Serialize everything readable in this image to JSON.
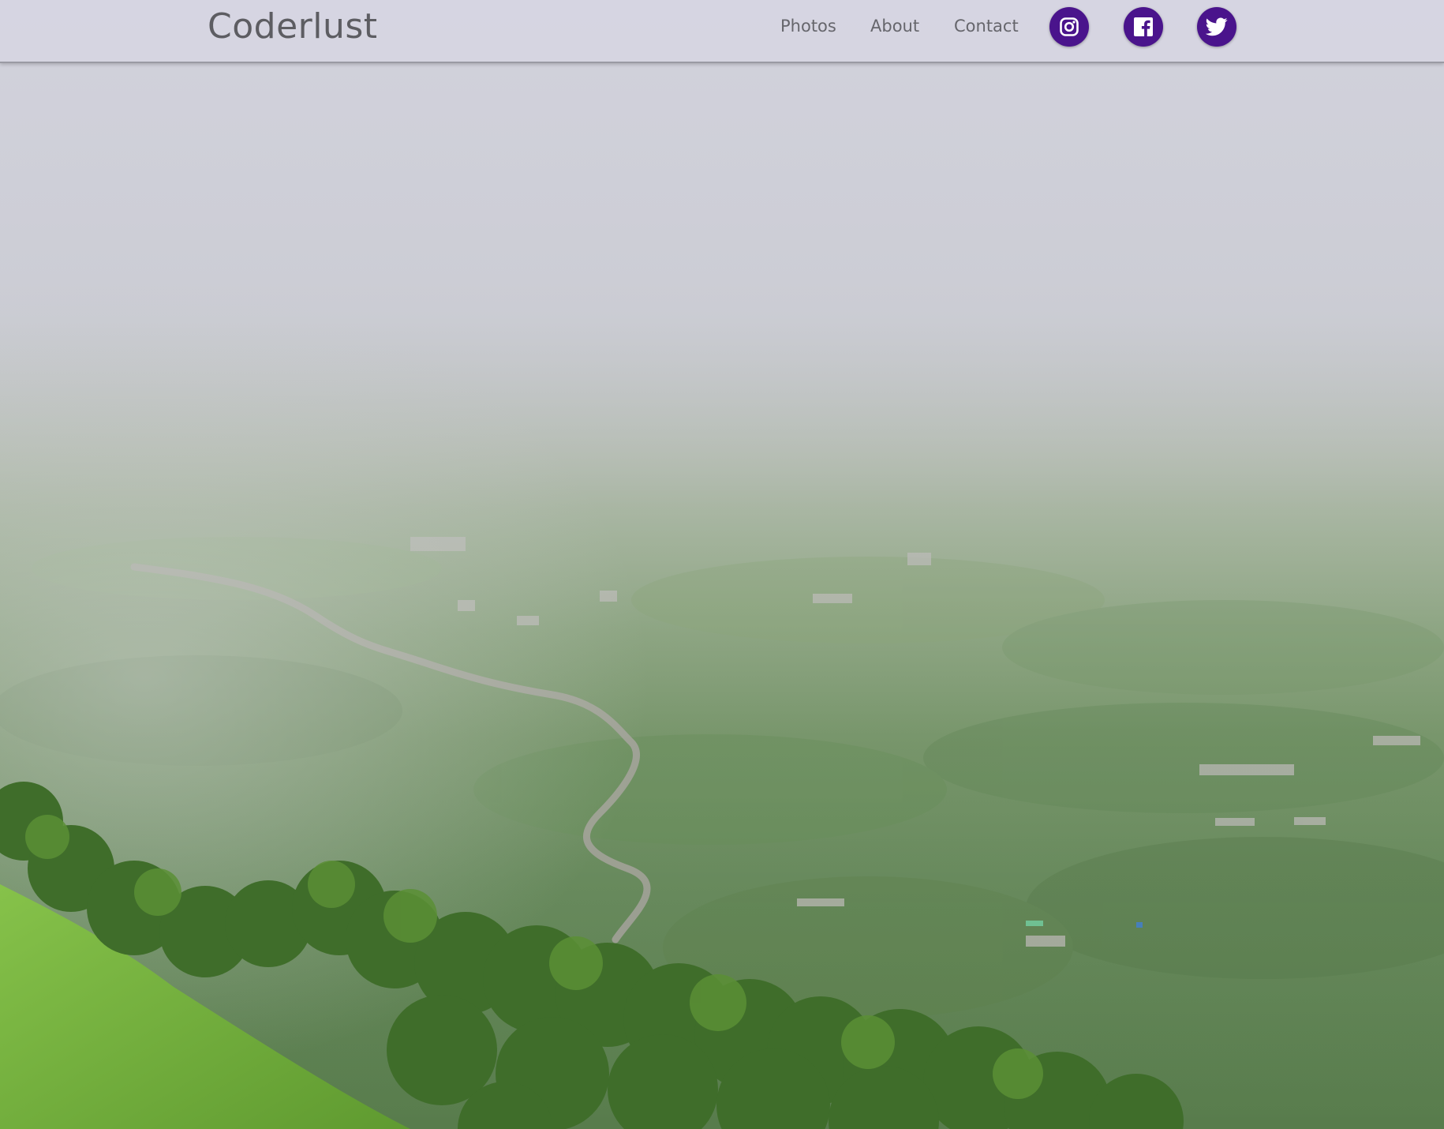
{
  "header": {
    "brand": "Coderlust",
    "nav": [
      {
        "label": "Photos"
      },
      {
        "label": "About"
      },
      {
        "label": "Contact"
      }
    ],
    "social": [
      {
        "icon": "instagram-icon"
      },
      {
        "icon": "facebook-icon"
      },
      {
        "icon": "twitter-icon"
      }
    ]
  },
  "hero": {
    "scene": "misty-valley-landscape"
  },
  "colors": {
    "header_bg": "#d6d5e2",
    "brand_text": "#5d5d62",
    "nav_text": "#66666c",
    "social_bg": "#4a148c",
    "social_icon": "#ffffff"
  }
}
